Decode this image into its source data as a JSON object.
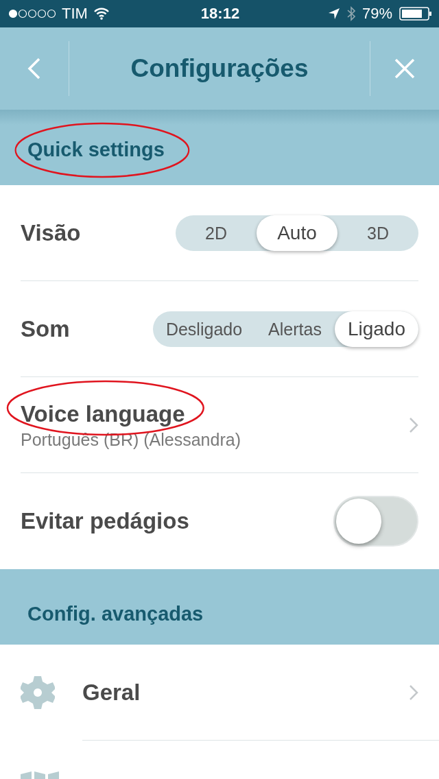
{
  "status_bar": {
    "carrier": "TIM",
    "time": "18:12",
    "battery": "79%"
  },
  "nav": {
    "title": "Configurações"
  },
  "sections": [
    {
      "title": "Quick settings",
      "circled": true,
      "rows": [
        {
          "kind": "segmented",
          "label": "Visão",
          "options": [
            {
              "label": "2D",
              "selected": false
            },
            {
              "label": "Auto",
              "selected": true
            },
            {
              "label": "3D",
              "selected": false
            }
          ]
        },
        {
          "kind": "segmented",
          "label": "Som",
          "options": [
            {
              "label": "Desligado",
              "selected": false
            },
            {
              "label": "Alertas",
              "selected": false
            },
            {
              "label": "Ligado",
              "selected": true
            }
          ]
        },
        {
          "kind": "link",
          "label": "Voice language",
          "value": "Português (BR) (Alessandra)",
          "circled": true
        },
        {
          "kind": "toggle",
          "label": "Evitar pedágios",
          "on": false
        }
      ]
    },
    {
      "title": "Config. avançadas",
      "circled": false,
      "rows": [
        {
          "kind": "link",
          "label": "Geral",
          "circled": false
        },
        {
          "kind": "link",
          "circled": false
        }
      ]
    }
  ]
}
